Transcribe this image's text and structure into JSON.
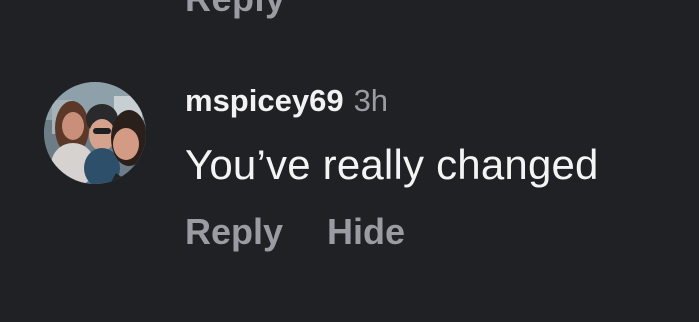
{
  "partial_top_text": "Reply",
  "comment": {
    "username": "mspicey69",
    "time": "3h",
    "text": "You’ve really changed",
    "actions": {
      "reply": "Reply",
      "hide": "Hide"
    },
    "avatar": {
      "icon": "user-photo-avatar"
    }
  },
  "colors": {
    "background": "#202124",
    "primary_text": "#f2f2f2",
    "secondary_text": "#9a9ca3"
  }
}
